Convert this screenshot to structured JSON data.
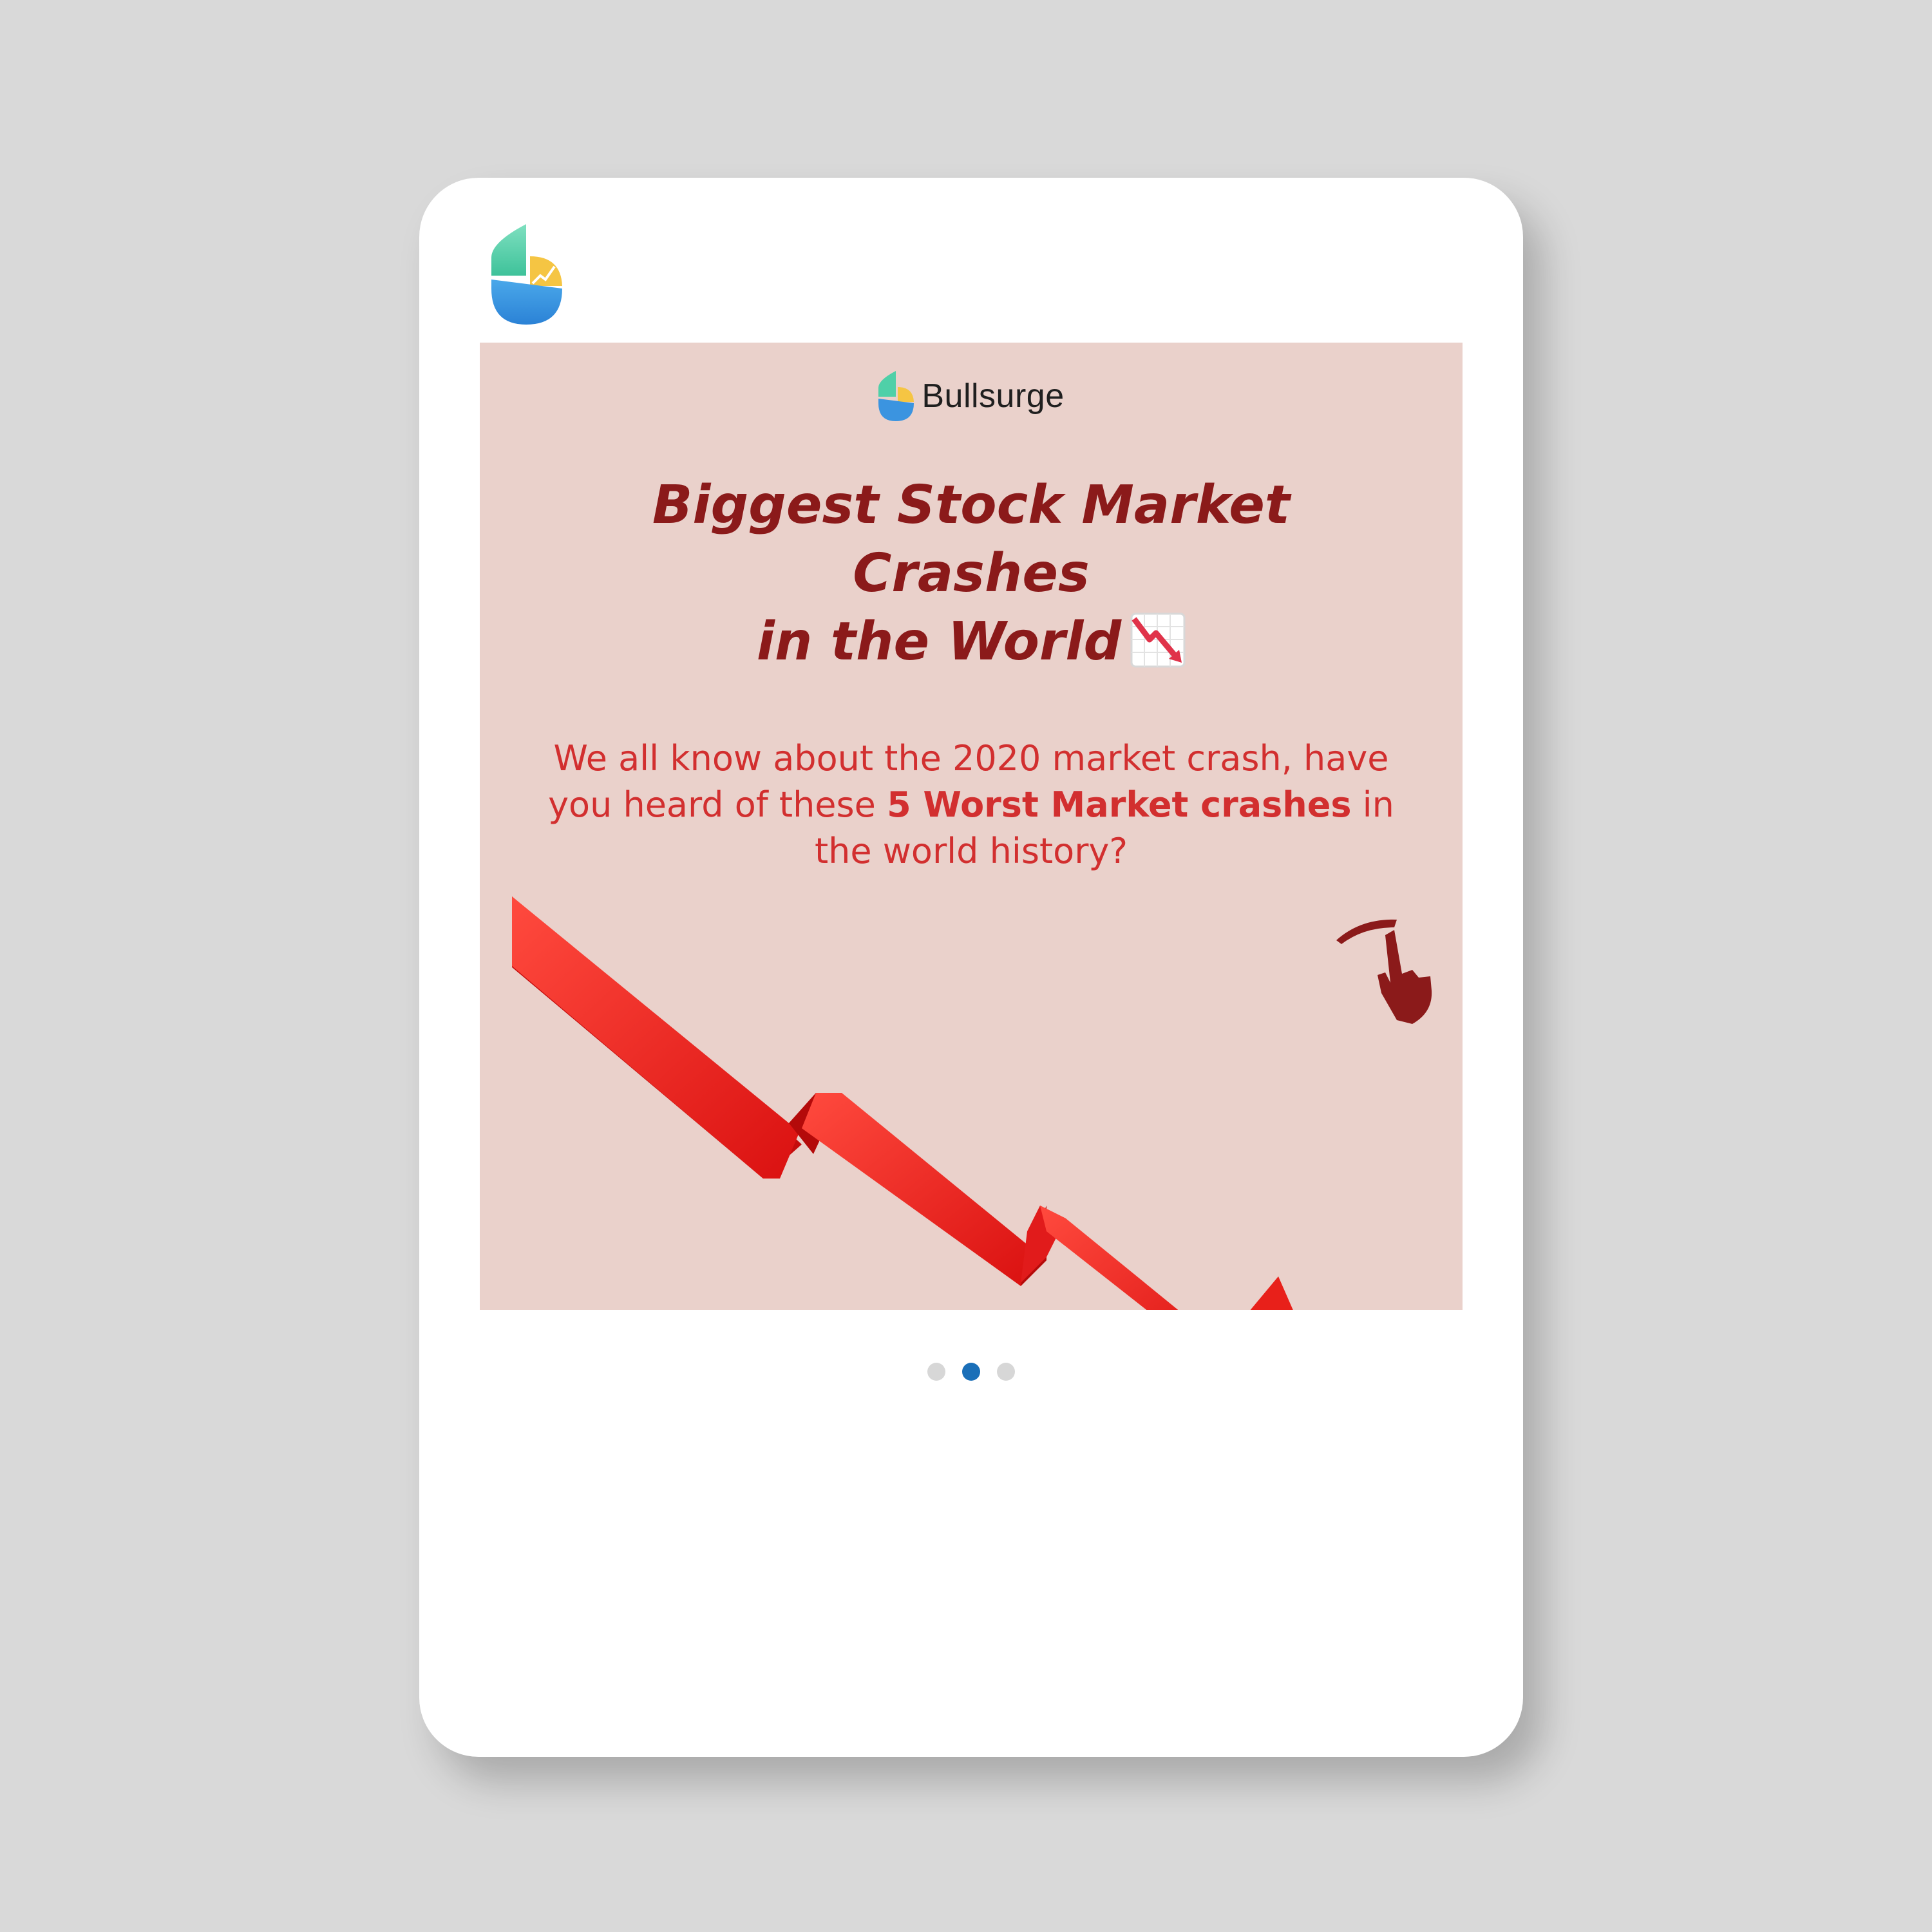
{
  "brand": {
    "name": "Bullsurge"
  },
  "headline": {
    "line1": "Biggest Stock Market",
    "line2": "Crashes",
    "line3": "in the World"
  },
  "subtitle": {
    "part1": "We all know about the 2020 market crash, have you heard of these ",
    "bold": "5 Worst Market crashes",
    "part2": " in the world history?"
  },
  "icons": {
    "top_logo": "bullsurge-logo-icon",
    "chart_emoji": "chart-decreasing-icon",
    "arrow": "downtrend-arrow-icon",
    "hand": "swipe-hand-icon"
  },
  "carousel": {
    "total": 3,
    "active_index": 1
  },
  "colors": {
    "background": "#d9d9d9",
    "slide_bg": "#ead1cb",
    "headline": "#8b1a1a",
    "subtitle": "#d22f2f",
    "arrow": "#e8201a",
    "dot_active": "#1a6fb8",
    "dot_inactive": "#d7d7d7"
  }
}
